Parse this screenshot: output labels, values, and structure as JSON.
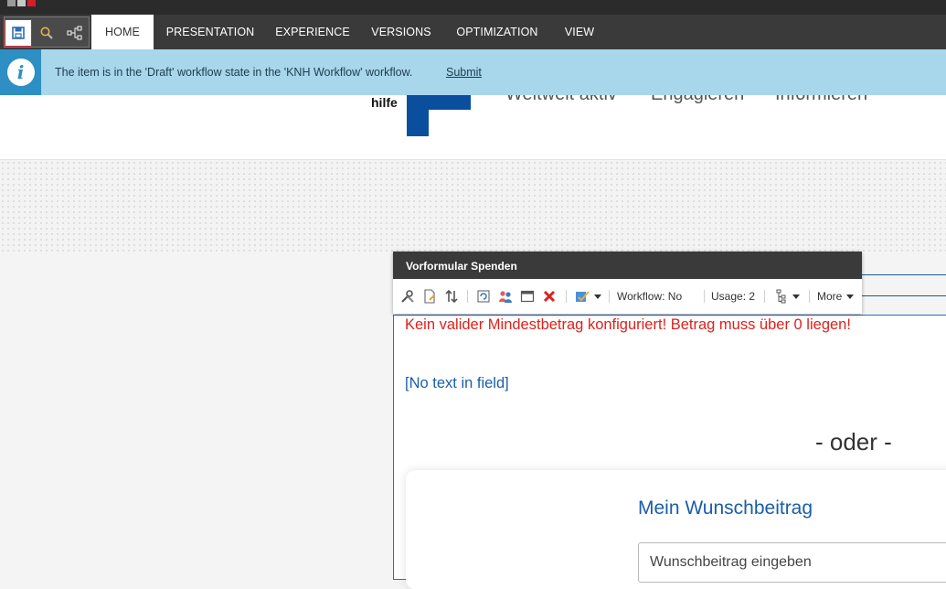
{
  "ribbon": {
    "tabs": [
      "HOME",
      "PRESENTATION",
      "EXPERIENCE",
      "VERSIONS",
      "OPTIMIZATION",
      "VIEW"
    ],
    "active_tab": "HOME",
    "quick_actions": [
      "save-icon",
      "search-icon",
      "navigator-icon"
    ]
  },
  "notice": {
    "text": "The item is in the 'Draft' workflow state in the 'KNH Workflow' workflow.",
    "link": "Submit",
    "icon": "info-icon"
  },
  "site": {
    "logo_word": "hilfe",
    "menu": [
      "Weltweit aktiv",
      "Engagieren",
      "Informieren"
    ],
    "brand_color": "#0a4f9e"
  },
  "rendering": {
    "title": "Vorformular Spenden",
    "workflow": "Workflow: No",
    "usage": "Usage: 2",
    "more": "More",
    "tools": [
      "properties-icon",
      "edit-item-icon",
      "sort-icon",
      "replace-icon",
      "personalize-icon",
      "layout-icon",
      "delete-icon",
      "edit-related-icon",
      "tree-icon"
    ]
  },
  "content": {
    "error": "Kein valider Mindestbetrag konfiguriert! Betrag muss über 0 liegen!",
    "empty_field": "[No text in field]",
    "oder": "- oder -",
    "card_title": "Mein Wunschbeitrag",
    "card_placeholder": "Wunschbeitrag eingeben"
  }
}
